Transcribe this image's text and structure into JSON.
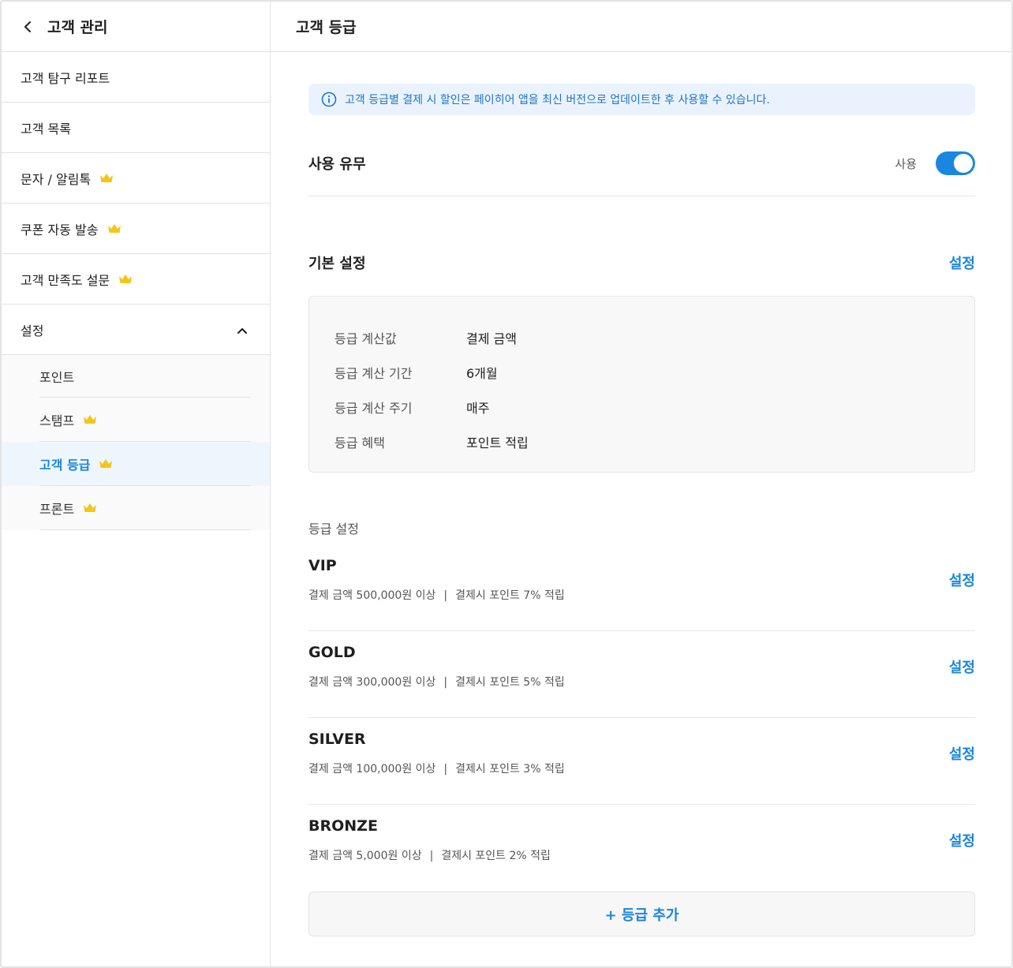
{
  "sidebar": {
    "title": "고객 관리",
    "items": [
      {
        "label": "고객 탐구 리포트",
        "premium": false
      },
      {
        "label": "고객 목록",
        "premium": false
      },
      {
        "label": "문자 / 알림톡",
        "premium": true
      },
      {
        "label": "쿠폰 자동 발송",
        "premium": true
      },
      {
        "label": "고객 만족도 설문",
        "premium": true
      },
      {
        "label": "설정",
        "expanded": true
      }
    ],
    "sub_items": [
      {
        "label": "포인트",
        "premium": false
      },
      {
        "label": "스탬프",
        "premium": true
      },
      {
        "label": "고객 등급",
        "premium": true,
        "active": true
      },
      {
        "label": "프론트",
        "premium": true
      }
    ]
  },
  "main": {
    "title": "고객 등급",
    "notice": "고객 등급별 결제 시 할인은 페이히어 앱을 최신 버전으로 업데이트한 후 사용할 수 있습니다.",
    "usage": {
      "label": "사용 유무",
      "toggle_text": "사용",
      "enabled": true
    },
    "basic": {
      "title": "기본 설정",
      "action": "설정",
      "rows": [
        {
          "key": "등급 계산값",
          "value": "결제 금액"
        },
        {
          "key": "등급 계산 기간",
          "value": "6개월"
        },
        {
          "key": "등급 계산 주기",
          "value": "매주"
        },
        {
          "key": "등급 혜택",
          "value": "포인트 적립"
        }
      ]
    },
    "grades_title": "등급 설정",
    "grades": [
      {
        "name": "VIP",
        "condition": "결제 금액 500,000원 이상",
        "benefit": "결제시 포인트 7% 적립",
        "action": "설정"
      },
      {
        "name": "GOLD",
        "condition": "결제 금액 300,000원 이상",
        "benefit": "결제시 포인트 5% 적립",
        "action": "설정"
      },
      {
        "name": "SILVER",
        "condition": "결제 금액 100,000원 이상",
        "benefit": "결제시 포인트 3% 적립",
        "action": "설정"
      },
      {
        "name": "BRONZE",
        "condition": "결제 금액 5,000원 이상",
        "benefit": "결제시 포인트 2% 적립",
        "action": "설정"
      }
    ],
    "separator": "|",
    "add_grade": "+ 등급 추가"
  },
  "colors": {
    "accent": "#1a86d8",
    "crown": "#f5c518",
    "toggle": "#1a86e0"
  }
}
